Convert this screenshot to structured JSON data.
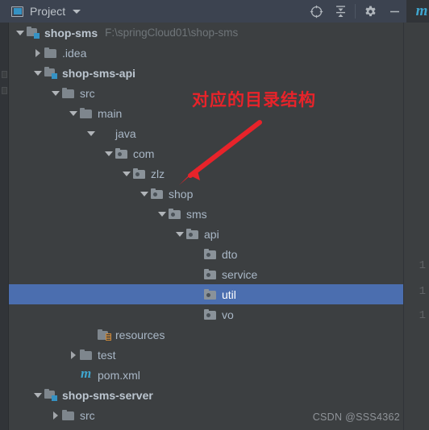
{
  "toolbar": {
    "title": "Project",
    "project_icon": "project-window-icon",
    "dropdown_icon": "chevron-down-icon",
    "buttons": [
      {
        "name": "locate-icon",
        "label": ""
      },
      {
        "name": "collapse-all-icon",
        "label": ""
      },
      {
        "name": "settings-gear-icon",
        "label": ""
      },
      {
        "name": "minimize-icon",
        "label": ""
      }
    ],
    "maven_tab_label": "m"
  },
  "tree": {
    "rows": [
      {
        "label": "shop-sms",
        "path": "F:\\springCloud01\\shop-sms",
        "depth": 0,
        "twisty": "down",
        "icon": "module",
        "bold": true,
        "selected": false
      },
      {
        "label": ".idea",
        "path": "",
        "depth": 1,
        "twisty": "right",
        "icon": "folder",
        "bold": false,
        "selected": false
      },
      {
        "label": "shop-sms-api",
        "path": "",
        "depth": 1,
        "twisty": "down",
        "icon": "module",
        "bold": true,
        "selected": false
      },
      {
        "label": "src",
        "path": "",
        "depth": 2,
        "twisty": "down",
        "icon": "folder",
        "bold": false,
        "selected": false
      },
      {
        "label": "main",
        "path": "",
        "depth": 3,
        "twisty": "down",
        "icon": "folder",
        "bold": false,
        "selected": false
      },
      {
        "label": "java",
        "path": "",
        "depth": 4,
        "twisty": "down",
        "icon": "folder-src",
        "bold": false,
        "selected": false
      },
      {
        "label": "com",
        "path": "",
        "depth": 5,
        "twisty": "down",
        "icon": "pkg",
        "bold": false,
        "selected": false
      },
      {
        "label": "zlz",
        "path": "",
        "depth": 6,
        "twisty": "down",
        "icon": "pkg",
        "bold": false,
        "selected": false
      },
      {
        "label": "shop",
        "path": "",
        "depth": 7,
        "twisty": "down",
        "icon": "pkg",
        "bold": false,
        "selected": false
      },
      {
        "label": "sms",
        "path": "",
        "depth": 8,
        "twisty": "down",
        "icon": "pkg",
        "bold": false,
        "selected": false
      },
      {
        "label": "api",
        "path": "",
        "depth": 9,
        "twisty": "down",
        "icon": "pkg",
        "bold": false,
        "selected": false
      },
      {
        "label": "dto",
        "path": "",
        "depth": 10,
        "twisty": "none",
        "icon": "pkg",
        "bold": false,
        "selected": false
      },
      {
        "label": "service",
        "path": "",
        "depth": 10,
        "twisty": "none",
        "icon": "pkg",
        "bold": false,
        "selected": false
      },
      {
        "label": "util",
        "path": "",
        "depth": 10,
        "twisty": "none",
        "icon": "pkg",
        "bold": false,
        "selected": true
      },
      {
        "label": "vo",
        "path": "",
        "depth": 10,
        "twisty": "none",
        "icon": "pkg",
        "bold": false,
        "selected": false
      },
      {
        "label": "resources",
        "path": "",
        "depth": 4,
        "twisty": "none",
        "icon": "resources",
        "bold": false,
        "selected": false
      },
      {
        "label": "test",
        "path": "",
        "depth": 3,
        "twisty": "right",
        "icon": "folder",
        "bold": false,
        "selected": false
      },
      {
        "label": "pom.xml",
        "path": "",
        "depth": 3,
        "twisty": "none",
        "icon": "maven",
        "bold": false,
        "selected": false
      },
      {
        "label": "shop-sms-server",
        "path": "",
        "depth": 1,
        "twisty": "down",
        "icon": "module",
        "bold": true,
        "selected": false
      },
      {
        "label": "src",
        "path": "",
        "depth": 2,
        "twisty": "right",
        "icon": "folder",
        "bold": false,
        "selected": false
      }
    ]
  },
  "editor_gutter": {
    "line_numbers": [
      "1",
      "1",
      "1"
    ]
  },
  "annotations": {
    "text": "对应的目录结构",
    "arrow_color": "#e8232a",
    "text_color": "#e8232a"
  },
  "watermark": {
    "text": "CSDN @SSS4362"
  },
  "colors": {
    "toolbar_bg": "#3c4350",
    "tree_bg": "#3c3f41",
    "selection_bg": "#4b6eaf",
    "text": "#a9b7c6",
    "muted_text": "#6f7579",
    "accent_teal": "#3592c4",
    "resource_orange": "#c9873a"
  }
}
